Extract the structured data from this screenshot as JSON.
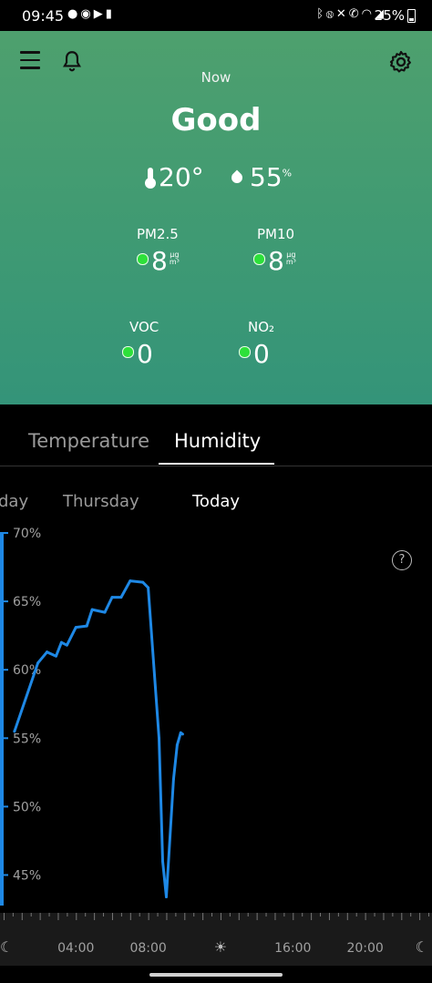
{
  "statusbar": {
    "time": "09:45",
    "battery": "25%",
    "icons_left": [
      "spotify-icon",
      "reddit-icon",
      "youtube-icon",
      "battery-saver-icon"
    ],
    "icons_right": [
      "bluetooth-icon",
      "nfc-icon",
      "mute-icon",
      "wifi-call-icon",
      "wifi-icon",
      "signal-icon"
    ]
  },
  "hero": {
    "now_label": "Now",
    "status": "Good",
    "temperature": "20°",
    "humidity": "55",
    "humidity_unit": "%",
    "metrics": [
      {
        "label": "PM2.5",
        "value": "8",
        "unit_top": "µg",
        "unit_bottom": "m³",
        "color": "#2de03a"
      },
      {
        "label": "PM10",
        "value": "8",
        "unit_top": "µg",
        "unit_bottom": "m³",
        "color": "#2de03a"
      },
      {
        "label": "VOC",
        "value": "0",
        "unit_top": "",
        "unit_bottom": "",
        "color": "#2de03a"
      },
      {
        "label": "NO₂",
        "value": "0",
        "unit_top": "",
        "unit_bottom": "",
        "color": "#2de03a"
      }
    ],
    "gradient_top": "#4ea06e",
    "gradient_bottom": "#349479"
  },
  "tabs": [
    {
      "label": "Temperature",
      "selected": false
    },
    {
      "label": "Humidity",
      "selected": true
    }
  ],
  "days": {
    "prev": "day",
    "thursday": "Thursday",
    "today": "Today"
  },
  "chart_data": {
    "type": "line",
    "y_ticks": [
      "70%",
      "65%",
      "60%",
      "55%",
      "50%",
      "45%"
    ],
    "x_ticks": [
      "04:00",
      "08:00",
      "16:00",
      "20:00"
    ],
    "x_markers": [
      "sun-icon",
      "moon-icon"
    ],
    "ylim": [
      42.5,
      71
    ],
    "xlim": [
      -0.2,
      23.7
    ],
    "grid": false,
    "line_color": "#1e88e5",
    "series": [
      {
        "x": [
          0.6,
          1.9,
          2.4,
          2.9,
          3.2,
          3.5,
          4.0,
          4.6,
          4.9,
          5.6,
          6.0,
          6.5,
          7.0,
          7.7,
          8.0,
          8.6,
          8.8,
          9.0,
          9.4,
          9.6,
          9.8,
          9.9
        ],
        "y": [
          55.5,
          60.5,
          61.3,
          61.0,
          62.0,
          61.8,
          63.1,
          63.2,
          64.4,
          64.2,
          65.3,
          65.3,
          66.5,
          66.4,
          66.0,
          55.0,
          46.0,
          43.4,
          52.0,
          54.5,
          55.4,
          55.3
        ]
      }
    ]
  }
}
